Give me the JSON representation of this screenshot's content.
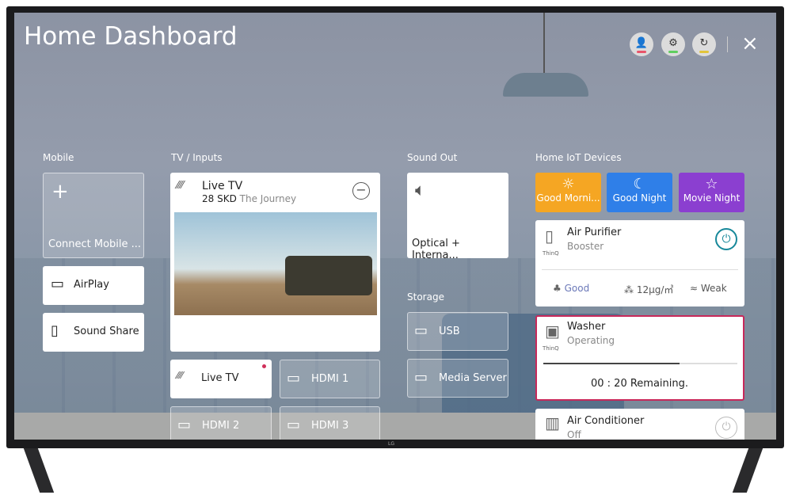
{
  "header": {
    "title": "Home Dashboard",
    "icons": [
      "user-star-icon",
      "gear-icon",
      "refresh-icon"
    ],
    "indicator_colors": [
      "#e8546a",
      "#5fcf5f",
      "#e2c43a"
    ],
    "close": "×"
  },
  "sections": {
    "mobile": "Mobile",
    "tv": "TV / Inputs",
    "sound": "Sound Out",
    "iot": "Home IoT Devices",
    "storage": "Storage"
  },
  "mobile": {
    "connect": "Connect Mobile ...",
    "airplay": "AirPlay",
    "sound_share": "Sound Share"
  },
  "tv": {
    "title": "Live TV",
    "channel": "28 SKD",
    "program": "The Journey",
    "inputs": [
      "Live TV",
      "HDMI 1",
      "HDMI 2",
      "HDMI 3"
    ]
  },
  "sound": {
    "output": "Optical + Interna..."
  },
  "storage": {
    "items": [
      "USB",
      "Media Server"
    ]
  },
  "iot": {
    "scenes": [
      {
        "label": "Good Morni...",
        "color": "#f5a623"
      },
      {
        "label": "Good Night",
        "color": "#2f7fe8"
      },
      {
        "label": "Movie Night",
        "color": "#8b3fd0"
      }
    ],
    "thinq": "ThinQ",
    "purifier": {
      "name": "Air Purifier",
      "mode": "Booster",
      "air": "Good",
      "pm": "12μg/㎥",
      "wind": "Weak"
    },
    "washer": {
      "name": "Washer",
      "status": "Operating",
      "remaining": "00 : 20 Remaining.",
      "progress": 0.7,
      "border": "#c8285a"
    },
    "ac": {
      "name": "Air Conditioner",
      "status": "Off"
    }
  },
  "brand": "LG"
}
